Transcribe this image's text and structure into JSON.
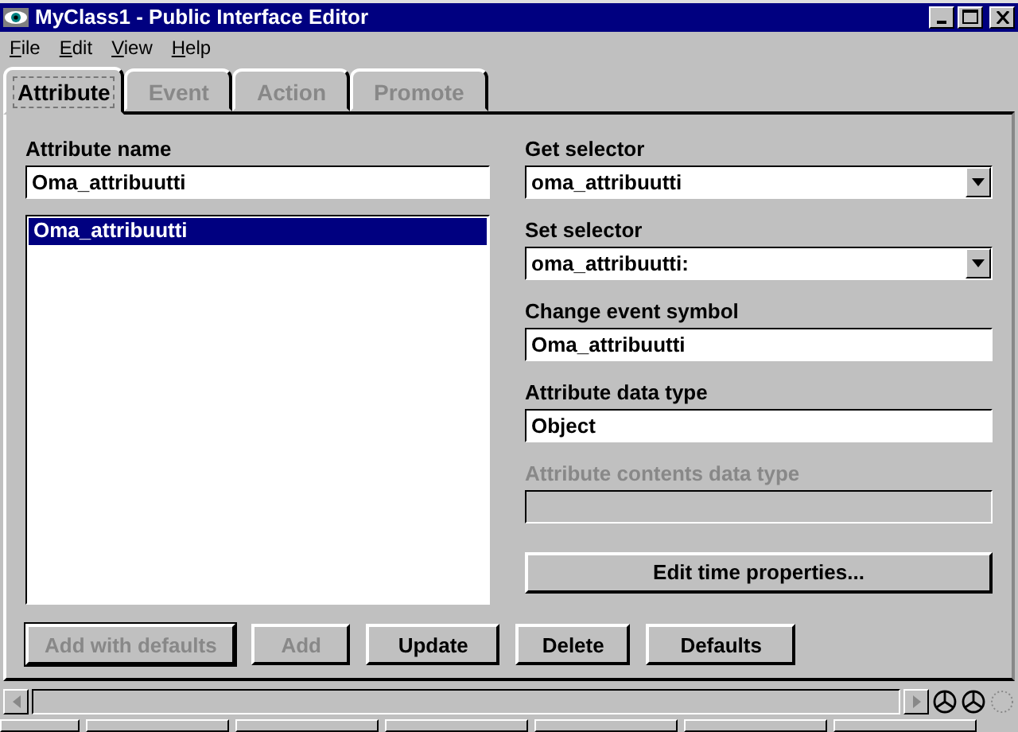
{
  "window": {
    "title": "MyClass1 - Public Interface Editor"
  },
  "menu": [
    "File",
    "Edit",
    "View",
    "Help"
  ],
  "tabs": [
    {
      "label": "Attribute",
      "selected": true,
      "disabled": false
    },
    {
      "label": "Event",
      "selected": false,
      "disabled": true
    },
    {
      "label": "Action",
      "selected": false,
      "disabled": true
    },
    {
      "label": "Promote",
      "selected": false,
      "disabled": true
    }
  ],
  "attribute_name": {
    "label": "Attribute name",
    "value": "Oma_attribuutti"
  },
  "attribute_list": [
    {
      "label": "Oma_attribuutti",
      "selected": true
    }
  ],
  "fields": [
    {
      "kind": "dropdown",
      "label": "Get selector",
      "value": "oma_attribuutti",
      "disabled": false
    },
    {
      "kind": "dropdown",
      "label": "Set selector",
      "value": "oma_attribuutti:",
      "disabled": false
    },
    {
      "kind": "text",
      "label": "Change event symbol",
      "value": "Oma_attribuutti",
      "disabled": false
    },
    {
      "kind": "text",
      "label": "Attribute data type",
      "value": "Object",
      "disabled": false
    },
    {
      "kind": "text",
      "label": "Attribute contents data type",
      "disabled": true
    }
  ],
  "edit_button": {
    "label": "Edit time properties...",
    "disabled": false
  },
  "buttons": [
    {
      "label": "Add with defaults",
      "disabled": true,
      "default": true
    },
    {
      "label": "Add",
      "disabled": true,
      "default": false
    },
    {
      "label": "Update",
      "disabled": false,
      "default": false
    },
    {
      "label": "Delete",
      "disabled": false,
      "default": false
    },
    {
      "label": "Defaults",
      "disabled": false,
      "default": false
    }
  ]
}
